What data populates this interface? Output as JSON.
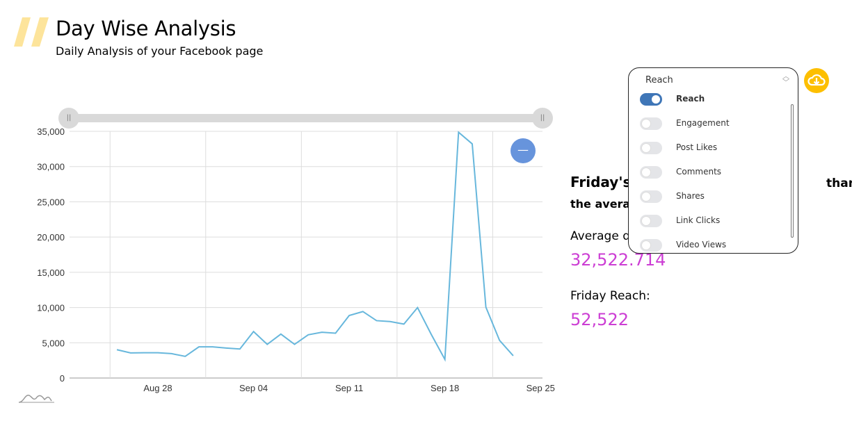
{
  "header": {
    "title": "Day Wise Analysis",
    "subtitle": "Daily Analysis of your Facebook page"
  },
  "insight": {
    "headline_start": "Friday's",
    "headline_end": "than",
    "line2_start": "the averag",
    "average_label_start": "Average d",
    "average_value": "32,522.714",
    "friday_label": "Friday Reach:",
    "friday_value": "52,522"
  },
  "dropdown": {
    "selected": "Reach",
    "options": [
      {
        "label": "Reach",
        "on": true
      },
      {
        "label": "Engagement",
        "on": false
      },
      {
        "label": "Post Likes",
        "on": false
      },
      {
        "label": "Comments",
        "on": false
      },
      {
        "label": "Shares",
        "on": false
      },
      {
        "label": "Link Clicks",
        "on": false
      },
      {
        "label": "Video Views",
        "on": false
      }
    ]
  },
  "colors": {
    "accent": "#fdbf00",
    "line": "#67b7dc",
    "value": "#cc3ed4",
    "toggle_on": "#3f76b7",
    "zoom_out_button": "#6794dc"
  },
  "icons": {
    "download": "cloud-download-icon",
    "zoom_out": "minus-icon",
    "logo": "amcharts-logo-icon"
  },
  "chart_data": {
    "type": "line",
    "x": [
      "Aug 25",
      "Aug 26",
      "Aug 27",
      "Aug 28",
      "Aug 29",
      "Aug 30",
      "Aug 31",
      "Sep 01",
      "Sep 02",
      "Sep 03",
      "Sep 04",
      "Sep 05",
      "Sep 06",
      "Sep 07",
      "Sep 08",
      "Sep 09",
      "Sep 10",
      "Sep 11",
      "Sep 12",
      "Sep 13",
      "Sep 14",
      "Sep 15",
      "Sep 16",
      "Sep 17",
      "Sep 18",
      "Sep 19",
      "Sep 20",
      "Sep 21",
      "Sep 22",
      "Sep 23"
    ],
    "series": [
      {
        "values": [
          4020,
          3560,
          3590,
          3590,
          3460,
          3070,
          4420,
          4420,
          4250,
          4120,
          6590,
          4780,
          6230,
          4780,
          6130,
          6490,
          6360,
          8870,
          9430,
          8140,
          8010,
          7650,
          9990,
          6200,
          2640,
          34870,
          33220,
          10050,
          5340,
          3160
        ]
      }
    ],
    "xticks": [
      "Aug 28",
      "Sep 04",
      "Sep 11",
      "Sep 18",
      "Sep 25"
    ],
    "yticks": [
      "0",
      "5,000",
      "10,000",
      "15,000",
      "20,000",
      "25,000",
      "30,000",
      "35,000"
    ],
    "ylim": [
      0,
      35000
    ],
    "grid": true
  }
}
